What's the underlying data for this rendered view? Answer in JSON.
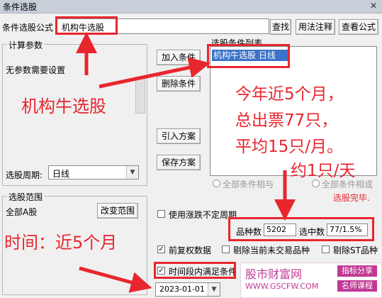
{
  "window": {
    "title": "条件选股",
    "close_label": "✕"
  },
  "formula_row": {
    "label": "条件选股公式",
    "formula_value": "机构牛选股",
    "find_button": "查找",
    "usage_button": "用法注释",
    "view_button": "查看公式"
  },
  "params": {
    "group_title": "计算参数",
    "no_params_text": "无参数需要设置",
    "period_label": "选股周期:",
    "period_value": "日线"
  },
  "buttons": {
    "add_condition": "加入条件",
    "delete_condition": "删除条件",
    "import_plan": "引入方案",
    "save_plan": "保存方案"
  },
  "condition_list": {
    "title": "选股条件列表",
    "items": [
      "机构牛选股  日线"
    ]
  },
  "logic": {
    "and_label": "全部条件相与",
    "or_label": "全部条件相或",
    "status": "选股完毕."
  },
  "range": {
    "group_title": "选股范围",
    "value": "全部A股",
    "change_button": "改变范围"
  },
  "options": {
    "use_rise_fall": "使用涨跌不定周期",
    "stock_count_label": "品种数",
    "stock_count_value": "5202",
    "selected_label": "选中数",
    "selected_value": "77/1.5%",
    "fq_data": "前复权数据",
    "exclude_untraded": "剔除当前未交易品种",
    "exclude_st": "剔除ST品种",
    "time_segment": "时间段内满足条件",
    "date_value": "2023-01-01"
  },
  "annotations": {
    "formula_callout": "机构牛选股",
    "summary_line1": "今年近5个月，",
    "summary_line2": "总出票77只，",
    "summary_line3": "平均15只/月。",
    "summary_line4": "约1只/天",
    "time_callout": "时间：近5个月"
  },
  "watermark": {
    "brand": "股市财富网",
    "url": "WWW.GSCFW.COM",
    "tag1": "指标分享",
    "tag2": "名师课程"
  },
  "colors": {
    "accent_red": "#e8262e",
    "list_selection": "#3a73c8"
  }
}
